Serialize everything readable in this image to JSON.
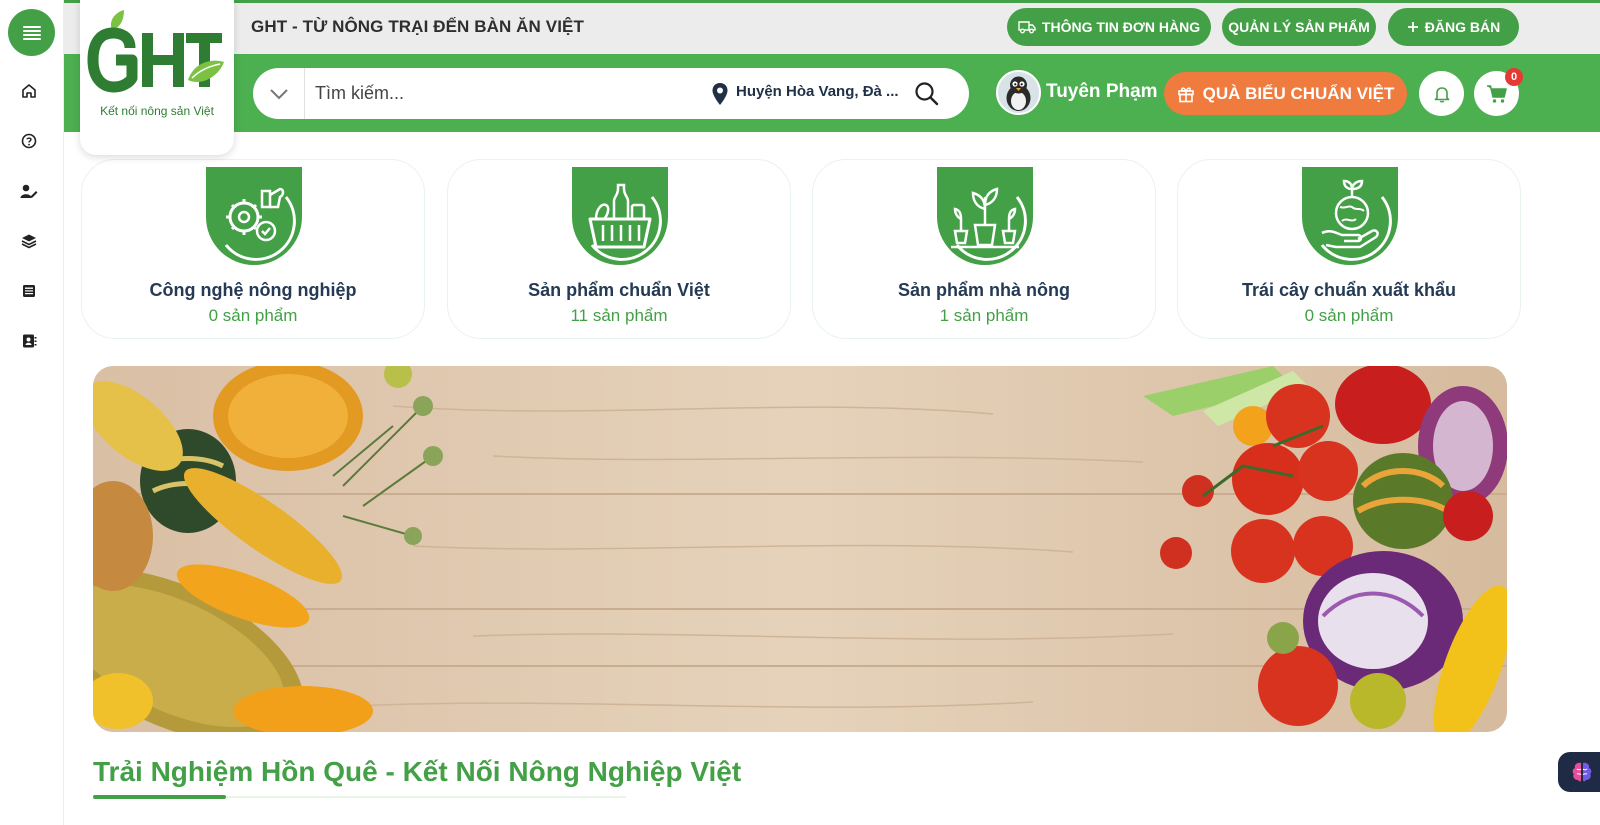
{
  "topbar": {
    "title": "GHT - TỪ NÔNG TRẠI ĐẾN BÀN ĂN VIỆT",
    "buttons": [
      {
        "label": "THÔNG TIN ĐƠN HÀNG",
        "icon": "truck-icon"
      },
      {
        "label": "QUẢN LÝ SẢN PHẨM"
      },
      {
        "label": "ĐĂNG BÁN",
        "icon": "plus-icon"
      }
    ]
  },
  "logo": {
    "tagline": "Kết nối nông sản Việt"
  },
  "sidebar": {
    "items": [
      {
        "icon": "home-icon"
      },
      {
        "icon": "help-circle-icon"
      },
      {
        "icon": "user-edit-icon"
      },
      {
        "icon": "layers-icon"
      },
      {
        "icon": "news-icon"
      },
      {
        "icon": "contact-book-icon"
      }
    ]
  },
  "search": {
    "placeholder": "Tìm kiếm...",
    "location": "Huyện Hòa Vang, Đà ..."
  },
  "user": {
    "name": "Tuyên Phạm"
  },
  "gift_button": {
    "label": "QUÀ BIẾU CHUẨN VIỆT"
  },
  "cart": {
    "count": "0"
  },
  "categories": [
    {
      "title": "Công nghệ nông nghiệp",
      "count": "0 sản phẩm",
      "icon": "agri-tech-icon"
    },
    {
      "title": "Sản phẩm chuẩn Việt",
      "count": "11 sản phẩm",
      "icon": "basket-icon"
    },
    {
      "title": "Sản phẩm nhà nông",
      "count": "1 sản phẩm",
      "icon": "plants-icon"
    },
    {
      "title": "Trái cây chuẩn xuất khẩu",
      "count": "0 sản phẩm",
      "icon": "globe-hand-icon"
    }
  ],
  "section": {
    "title": "Trải Nghiệm Hồn Quê - Kết Nối Nông Nghiệp Việt"
  },
  "colors": {
    "primary": "#43a047",
    "accent": "#f07b3f",
    "text_dark": "#243a55"
  }
}
